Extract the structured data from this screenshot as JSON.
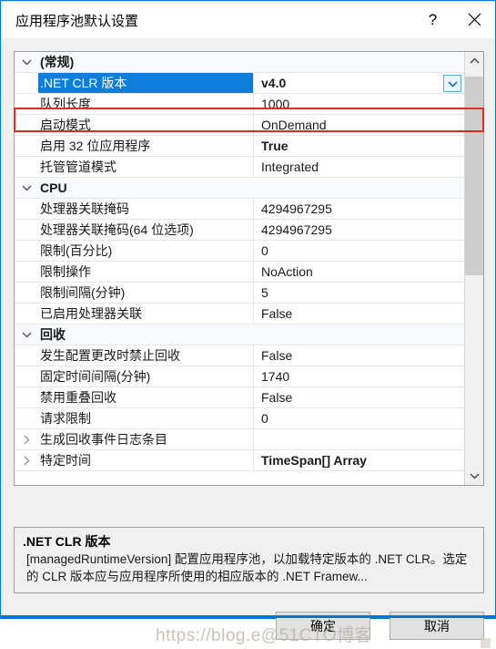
{
  "window": {
    "title": "应用程序池默认设置",
    "help_label": "?",
    "close_label": "×"
  },
  "grid": {
    "rows": [
      {
        "expander": "expanded",
        "name": "(常规)",
        "value": "",
        "category": true,
        "bold_value": false,
        "selected": false
      },
      {
        "expander": "none",
        "name": ".NET CLR 版本",
        "value": "v4.0",
        "category": false,
        "bold_value": true,
        "selected": true
      },
      {
        "expander": "none",
        "name": "队列长度",
        "value": "1000",
        "category": false,
        "bold_value": false,
        "selected": false
      },
      {
        "expander": "none",
        "name": "启动模式",
        "value": "OnDemand",
        "category": false,
        "bold_value": false,
        "selected": false
      },
      {
        "expander": "none",
        "name": "启用 32 位应用程序",
        "value": "True",
        "category": false,
        "bold_value": true,
        "selected": false
      },
      {
        "expander": "none",
        "name": "托管管道模式",
        "value": "Integrated",
        "category": false,
        "bold_value": false,
        "selected": false
      },
      {
        "expander": "expanded",
        "name": "CPU",
        "value": "",
        "category": true,
        "bold_value": false,
        "selected": false
      },
      {
        "expander": "none",
        "name": "处理器关联掩码",
        "value": "4294967295",
        "category": false,
        "bold_value": false,
        "selected": false
      },
      {
        "expander": "none",
        "name": "处理器关联掩码(64 位选项)",
        "value": "4294967295",
        "category": false,
        "bold_value": false,
        "selected": false
      },
      {
        "expander": "none",
        "name": "限制(百分比)",
        "value": "0",
        "category": false,
        "bold_value": false,
        "selected": false
      },
      {
        "expander": "none",
        "name": "限制操作",
        "value": "NoAction",
        "category": false,
        "bold_value": false,
        "selected": false
      },
      {
        "expander": "none",
        "name": "限制间隔(分钟)",
        "value": "5",
        "category": false,
        "bold_value": false,
        "selected": false
      },
      {
        "expander": "none",
        "name": "已启用处理器关联",
        "value": "False",
        "category": false,
        "bold_value": false,
        "selected": false
      },
      {
        "expander": "expanded",
        "name": "回收",
        "value": "",
        "category": true,
        "bold_value": false,
        "selected": false
      },
      {
        "expander": "none",
        "name": "发生配置更改时禁止回收",
        "value": "False",
        "category": false,
        "bold_value": false,
        "selected": false
      },
      {
        "expander": "none",
        "name": "固定时间间隔(分钟)",
        "value": "1740",
        "category": false,
        "bold_value": false,
        "selected": false
      },
      {
        "expander": "none",
        "name": "禁用重叠回收",
        "value": "False",
        "category": false,
        "bold_value": false,
        "selected": false
      },
      {
        "expander": "none",
        "name": "请求限制",
        "value": "0",
        "category": false,
        "bold_value": false,
        "selected": false
      },
      {
        "expander": "collapsed",
        "name": "生成回收事件日志条目",
        "value": "",
        "category": false,
        "bold_value": false,
        "selected": false
      },
      {
        "expander": "collapsed",
        "name": "特定时间",
        "value": "TimeSpan[] Array",
        "category": false,
        "bold_value": true,
        "selected": false
      }
    ],
    "scrollbar": {
      "up_arrow": "▲",
      "down_arrow": "▼"
    }
  },
  "description": {
    "title": ".NET CLR 版本",
    "text": "[managedRuntimeVersion] 配置应用程序池，以加载特定版本的 .NET CLR。选定的 CLR 版本应与应用程序所使用的相应版本的 .NET Framew..."
  },
  "buttons": {
    "ok": "确定",
    "cancel": "取消"
  },
  "watermark": {
    "text": "https://blog.e@51CTO博客"
  },
  "colors": {
    "accent": "#0078d7",
    "selection": "#0f7ddb",
    "annotation": "#e02b20",
    "button_face": "#e1e1e1",
    "dialog_face": "#f0f0f0"
  }
}
